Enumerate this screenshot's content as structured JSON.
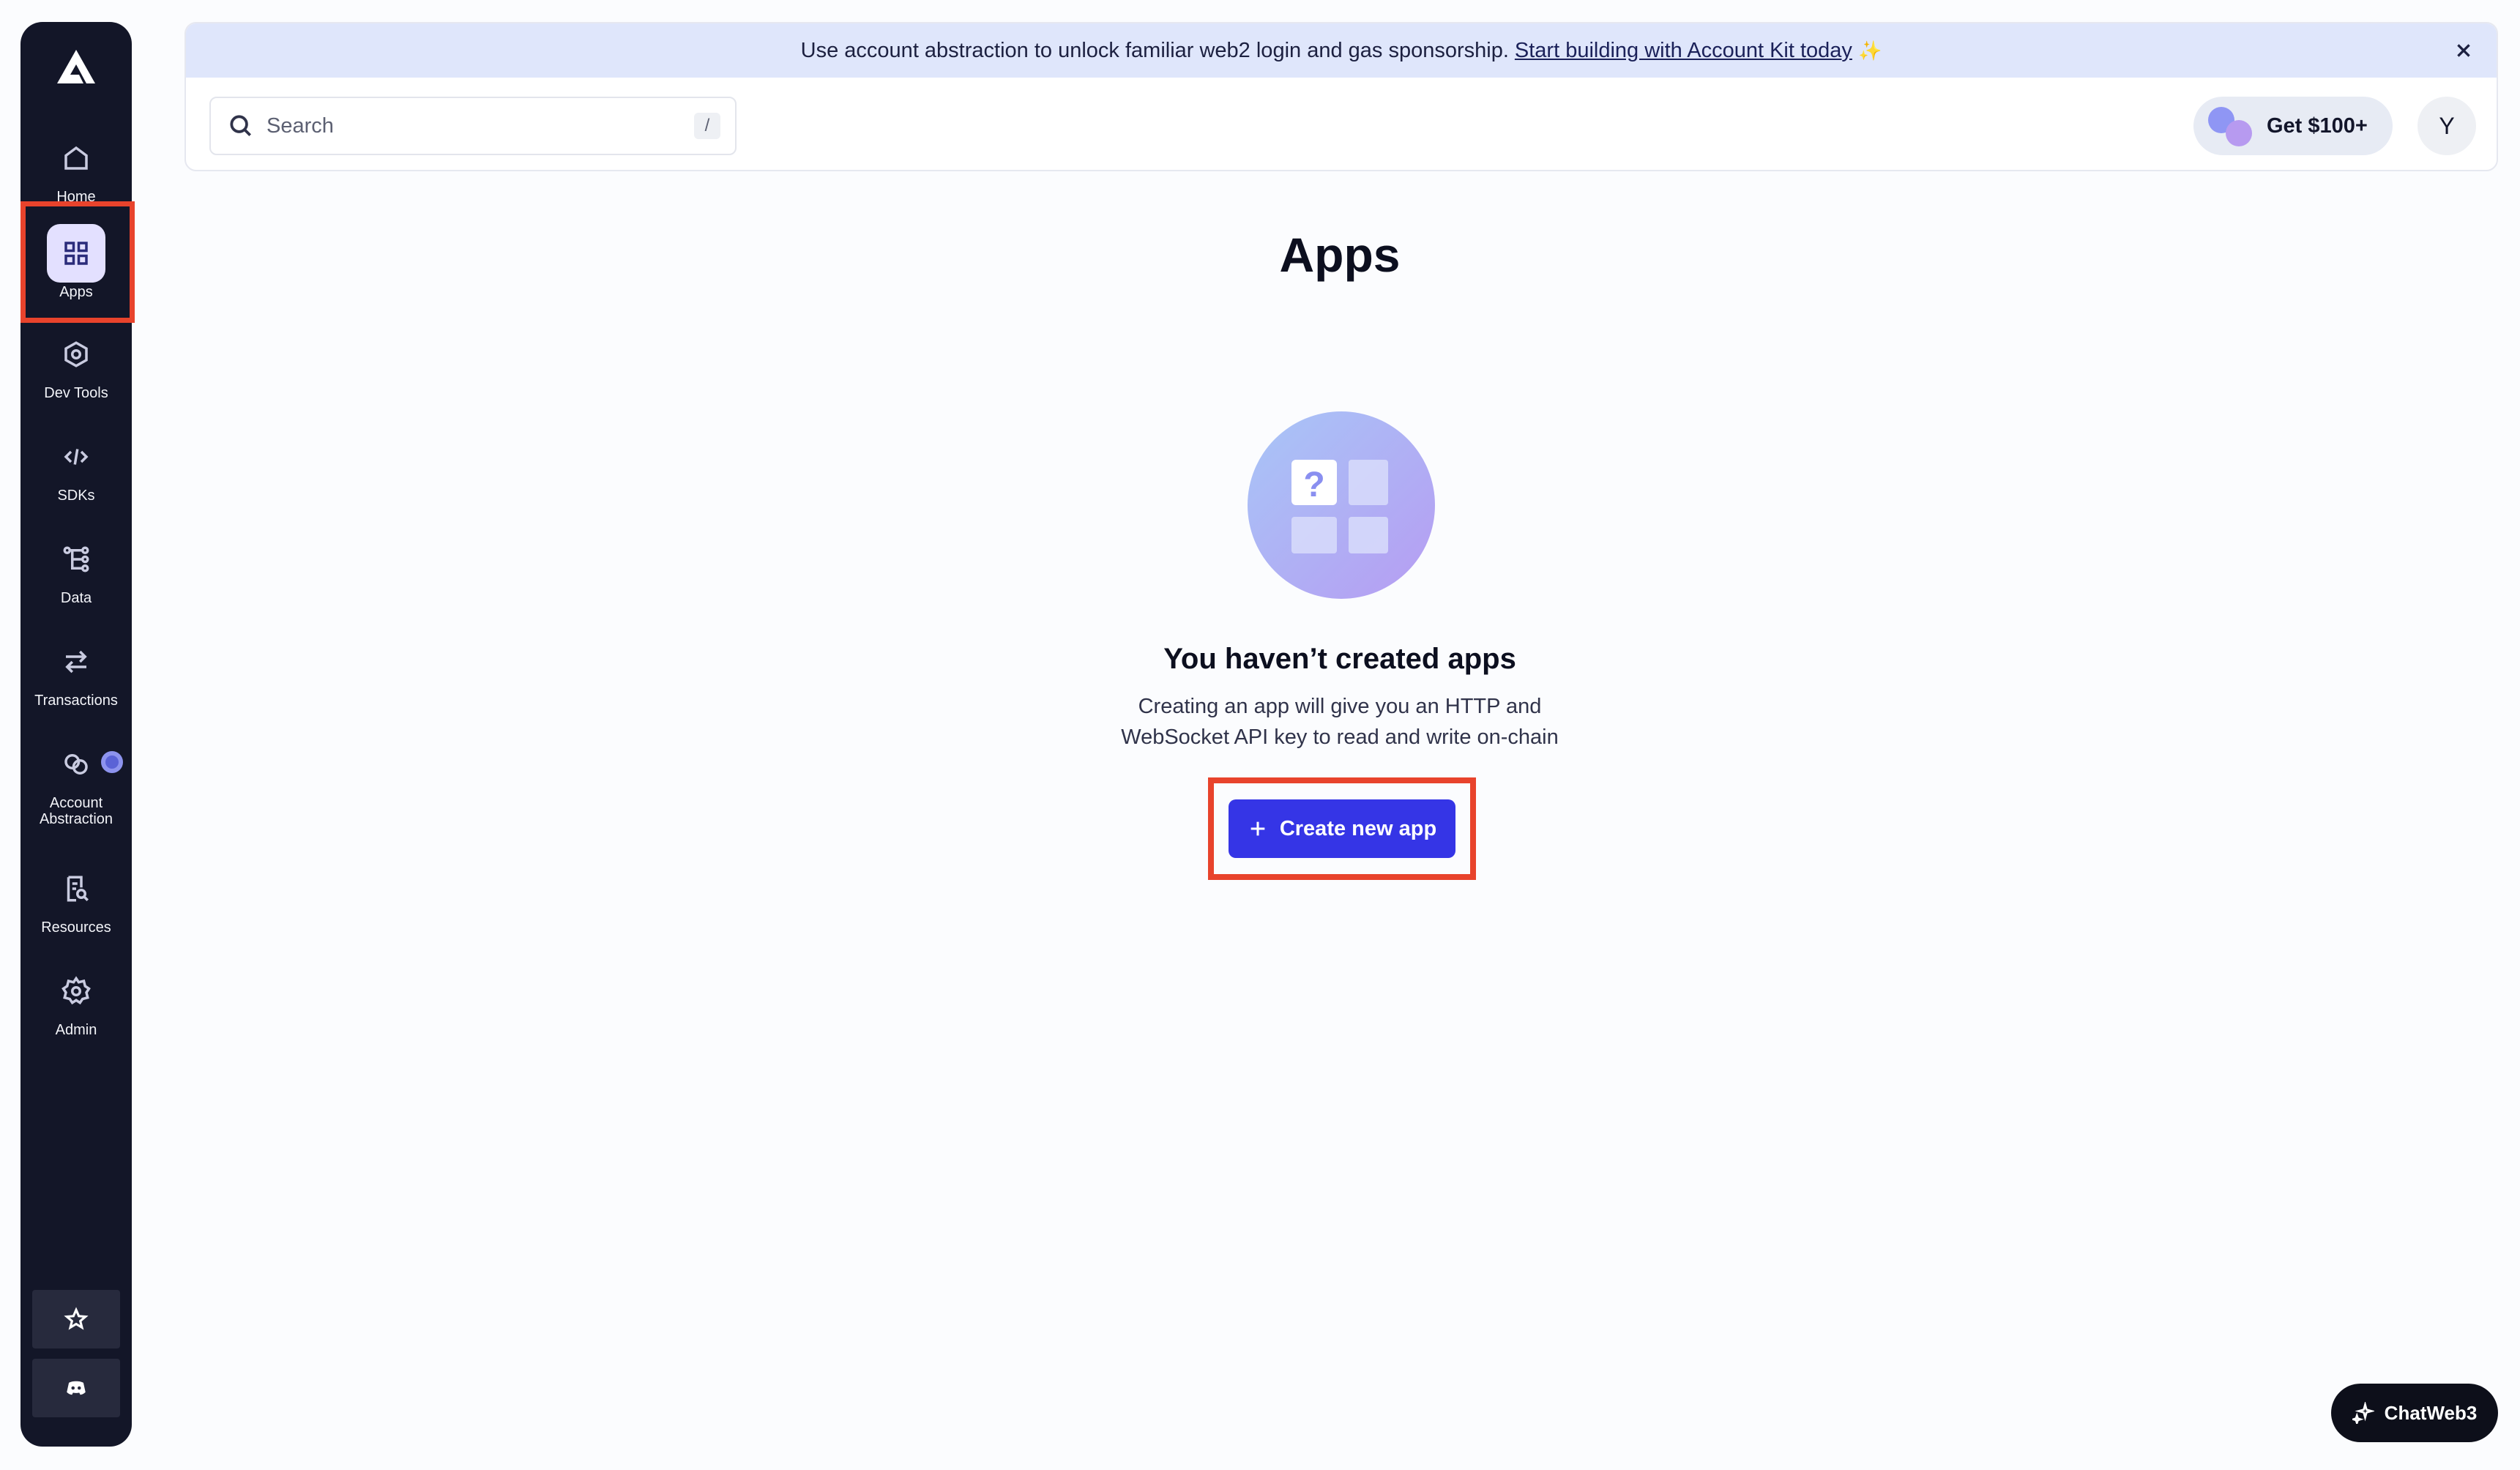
{
  "banner": {
    "text": "Use account abstraction to unlock familiar web2 login and gas sponsorship.",
    "link": "Start building with Account Kit today",
    "sparkle": "✨"
  },
  "search": {
    "placeholder": "Search",
    "shortcut": "/"
  },
  "header": {
    "promo_label": "Get $100+",
    "avatar_initial": "Y"
  },
  "sidebar": {
    "items": [
      {
        "label": "Home"
      },
      {
        "label": "Apps",
        "active": true
      },
      {
        "label": "Dev Tools"
      },
      {
        "label": "SDKs"
      },
      {
        "label": "Data"
      },
      {
        "label": "Transactions"
      },
      {
        "label": "Account Abstraction"
      },
      {
        "label": "Resources"
      },
      {
        "label": "Admin"
      }
    ]
  },
  "main": {
    "title": "Apps",
    "empty_title": "You haven’t created apps",
    "empty_desc_line1": "Creating an app will give you an HTTP and",
    "empty_desc_line2": "WebSocket API key to read and write on-chain",
    "create_button": "Create new app"
  },
  "chat": {
    "label": "ChatWeb3"
  },
  "colors": {
    "sidebar_bg": "#131628",
    "accent": "#3535e6",
    "highlight": "#e8432c",
    "banner_bg": "#dfe6fb"
  }
}
